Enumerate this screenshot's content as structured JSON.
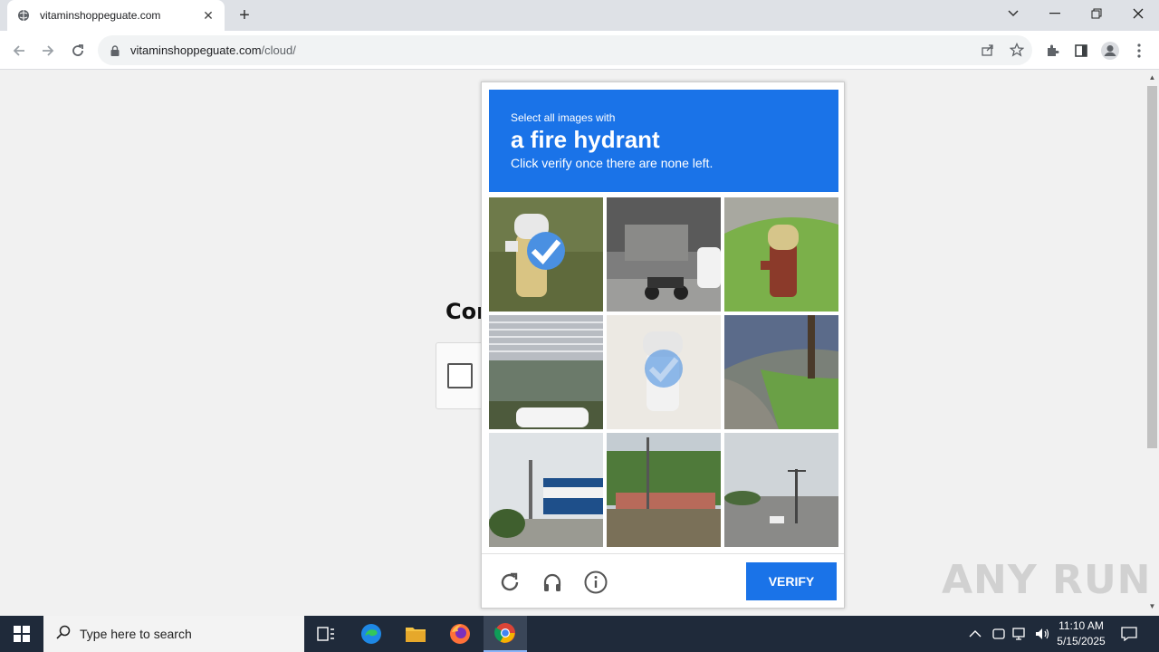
{
  "browser": {
    "tab_title": "vitaminshoppeguate.com",
    "tab_close": "✕",
    "new_tab": "+",
    "url_host": "vitaminshoppeguate.com",
    "url_path": "/cloud/"
  },
  "page": {
    "heading_partial": "Cor"
  },
  "captcha": {
    "instruction_small": "Select all images with",
    "target": "a fire hydrant",
    "instruction_sub": "Click verify once there are none left.",
    "verify_label": "VERIFY",
    "tiles": [
      {
        "subject": "white and yellow fire hydrant on grass",
        "selected": true
      },
      {
        "subject": "scooter parked near building entrance",
        "selected": false
      },
      {
        "subject": "red fire hydrant on grass",
        "selected": false
      },
      {
        "subject": "building facade with car",
        "selected": false
      },
      {
        "subject": "faded fire hydrant",
        "selected": true
      },
      {
        "subject": "curb and grass with pole",
        "selected": false
      },
      {
        "subject": "street lamp and building",
        "selected": false
      },
      {
        "subject": "fence with trees",
        "selected": false
      },
      {
        "subject": "intersection with power pole",
        "selected": false
      }
    ]
  },
  "watermark": "ANY RUN",
  "taskbar": {
    "search_placeholder": "Type here to search",
    "time": "11:10 AM",
    "date": "5/15/2025"
  },
  "colors": {
    "accent": "#1a73e8",
    "taskbar": "#1f2a3a"
  }
}
